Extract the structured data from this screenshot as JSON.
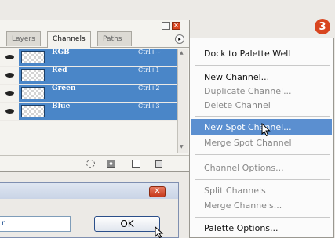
{
  "step_badge": "3",
  "palette": {
    "tabs": [
      "Layers",
      "Channels",
      "Paths"
    ],
    "active_tab": "Channels",
    "channels": [
      {
        "name": "RGB",
        "shortcut": "Ctrl+~"
      },
      {
        "name": "Red",
        "shortcut": "Ctrl+1"
      },
      {
        "name": "Green",
        "shortcut": "Ctrl+2"
      },
      {
        "name": "Blue",
        "shortcut": "Ctrl+3"
      }
    ],
    "selection_color": "#4a86c8"
  },
  "menu": {
    "items": [
      {
        "label": "Dock to Palette Well",
        "enabled": true
      },
      {
        "label": "New Channel...",
        "enabled": true
      },
      {
        "label": "Duplicate Channel...",
        "enabled": false
      },
      {
        "label": "Delete Channel",
        "enabled": false
      },
      {
        "label": "New Spot Channel...",
        "enabled": true,
        "highlighted": true
      },
      {
        "label": "Merge Spot Channel",
        "enabled": false
      },
      {
        "label": "Channel Options...",
        "enabled": false
      },
      {
        "label": "Split Channels",
        "enabled": false
      },
      {
        "label": "Merge Channels...",
        "enabled": false
      },
      {
        "label": "Palette Options...",
        "enabled": true
      }
    ],
    "highlight_color": "#5b8fd0"
  },
  "dialog": {
    "input_value": "r",
    "ok_label": "OK",
    "close_label": "✕"
  },
  "accent_color": "#d8451f"
}
